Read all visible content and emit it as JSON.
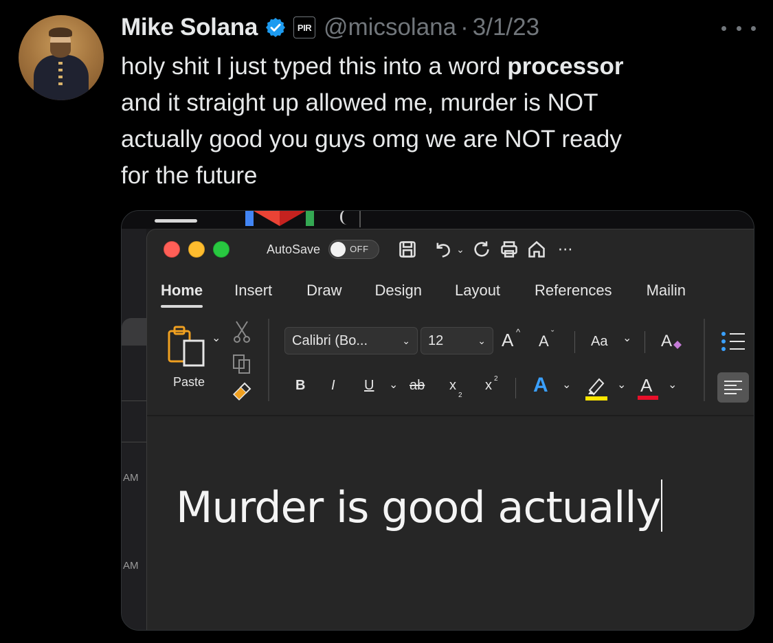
{
  "tweet": {
    "author_name": "Mike Solana",
    "affiliate_badge": "PIR",
    "handle": "@micsolana",
    "separator": "·",
    "date": "3/1/23",
    "text_lines": [
      [
        "holy shit I just typed this into a word ",
        "processor"
      ],
      [
        "and it straight up allowed me, murder is NOT",
        ""
      ],
      [
        "actually good you guys omg we are NOT ready",
        ""
      ],
      [
        "for the future",
        ""
      ]
    ],
    "icons": {
      "verified": "verified-check-icon",
      "more": "more-horizontal-icon"
    },
    "colors": {
      "verified": "#1d9bf0",
      "muted": "#71767b",
      "text": "#e7e9ea"
    }
  },
  "screenshot": {
    "background_labels": {
      "left_a": "AM",
      "left_b": "AM"
    },
    "word": {
      "autosave_label": "AutoSave",
      "autosave_state": "OFF",
      "tabs": [
        "Home",
        "Insert",
        "Draw",
        "Design",
        "Layout",
        "References",
        "Mailin"
      ],
      "active_tab": "Home",
      "paste_label": "Paste",
      "font_name": "Calibri (Bo...",
      "font_size": "12",
      "change_case": "Aa",
      "bold": "B",
      "italic": "I",
      "underline": "U",
      "strikethrough": "ab",
      "subscript": "x",
      "superscript": "x",
      "grow_font": "A",
      "shrink_font": "A",
      "text_effects": "A",
      "font_color": "A",
      "document_text": "Murder is good actually",
      "colors": {
        "highlight": "#ffe600",
        "font_color": "#e8102a",
        "text_effects": "#3aa0ff"
      }
    }
  }
}
